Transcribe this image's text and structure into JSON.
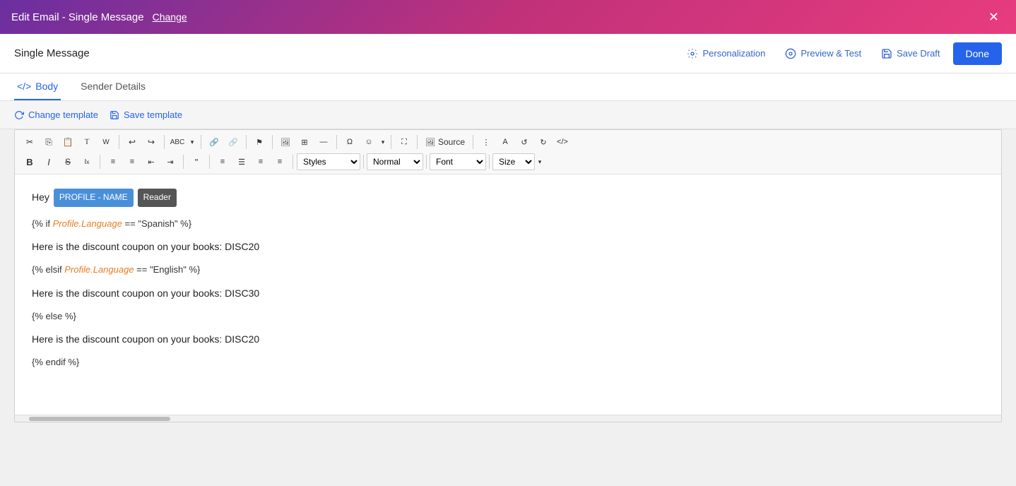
{
  "top_header": {
    "title": "Edit Email - Single Message",
    "change_label": "Change",
    "close_label": "✕"
  },
  "second_header": {
    "title": "Single Message",
    "personalization_label": "Personalization",
    "preview_label": "Preview & Test",
    "save_draft_label": "Save Draft",
    "done_label": "Done"
  },
  "tabs": [
    {
      "id": "body",
      "label": "Body",
      "icon": "</>",
      "active": true
    },
    {
      "id": "sender",
      "label": "Sender Details",
      "icon": "",
      "active": false
    }
  ],
  "template_actions": {
    "change_label": "Change template",
    "save_label": "Save template"
  },
  "toolbar": {
    "source_label": "Source",
    "styles_label": "Styles",
    "normal_label": "Normal",
    "font_label": "Font",
    "size_label": "Size"
  },
  "editor": {
    "content": {
      "hey_text": "Hey",
      "profile_name_tag": "PROFILE - NAME",
      "reader_tag": "Reader",
      "line1": "{% if Profile.Language == \"Spanish\" %}",
      "line2": "Here is the discount coupon on your books: DISC20",
      "line3": "{% elsif Profile.Language == \"English\" %}",
      "line4": "Here is the discount coupon on your books: DISC30",
      "line5": "{% else %}",
      "line6": "Here is the discount coupon on your books: DISC20",
      "line7": "{% endif %}"
    }
  },
  "colors": {
    "header_gradient_start": "#6b2fa0",
    "header_gradient_end": "#e83c7e",
    "active_tab_color": "#2563eb",
    "done_button": "#2563eb",
    "profile_tag_bg": "#4a90d9",
    "liquid_var_color": "#e67e22"
  }
}
